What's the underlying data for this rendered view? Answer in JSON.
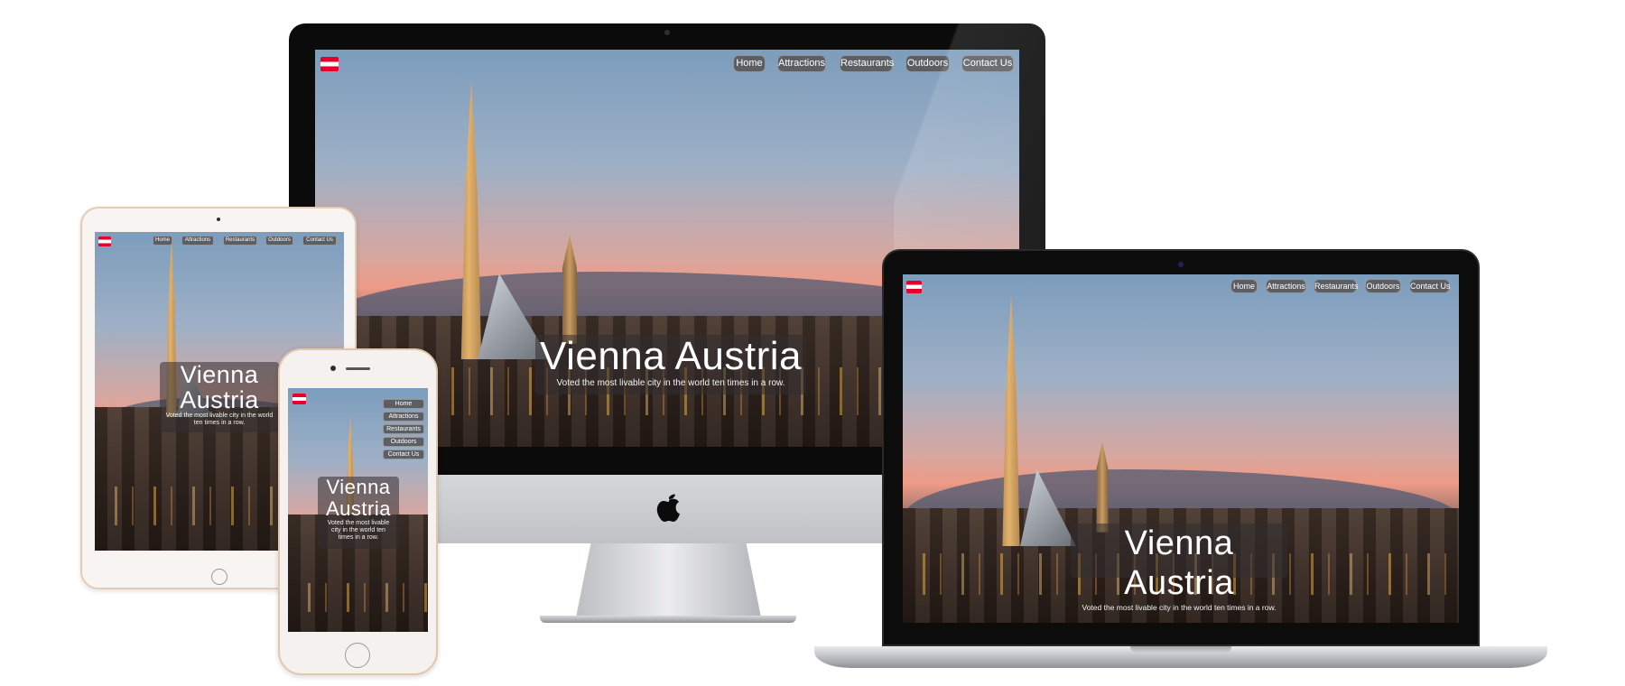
{
  "site": {
    "nav": [
      "Home",
      "Attractions",
      "Restaurants",
      "Outdoors",
      "Contact Us"
    ],
    "hero_title": "Vienna Austria",
    "hero_title_line1": "Vienna",
    "hero_title_line2": "Austria",
    "hero_subtitle": "Voted the most livable city in the world ten times in a row.",
    "flag_colors": [
      "#e4002b",
      "#ffffff",
      "#e4002b"
    ]
  },
  "devices": [
    "imac",
    "macbook",
    "ipad",
    "iphone"
  ]
}
